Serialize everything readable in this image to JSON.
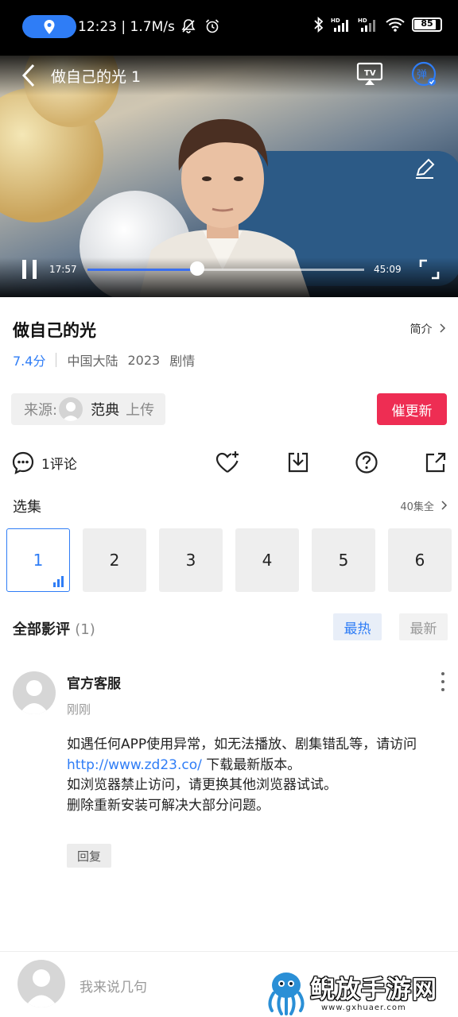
{
  "status": {
    "time": "12:23",
    "speed": "1.7M/s",
    "battery": "85"
  },
  "player": {
    "title": "做自己的光 1",
    "current_time": "17:57",
    "total_time": "45:09",
    "progress": 0.397,
    "danmaku_label": "弹",
    "tv_label": "TV"
  },
  "info": {
    "title": "做自己的光",
    "intro_label": "简介",
    "rating": "7.4分",
    "region": "中国大陆",
    "year": "2023",
    "genre": "剧情",
    "source_label": "来源:",
    "uploader": "范典",
    "upload_label": "上传",
    "urge_button": "催更新"
  },
  "actions": {
    "comment_count": "1评论"
  },
  "episodes": {
    "label": "选集",
    "total": "40集全",
    "items": [
      "1",
      "2",
      "3",
      "4",
      "5",
      "6"
    ],
    "active_index": 0
  },
  "reviews": {
    "label": "全部影评",
    "count": "(1)",
    "sort_hot": "最热",
    "sort_new": "最新",
    "comment": {
      "author": "官方客服",
      "time": "刚刚",
      "line1": "如遇任何APP使用异常，如无法播放、剧集错乱等，请访问",
      "link": "http://www.zd23.co/",
      "line2": "下载最新版本。",
      "line3": "如浏览器禁止访问，请更换其他浏览器试试。",
      "line4": "删除重新安装可解决大部分问题。",
      "reply_label": "回复"
    }
  },
  "bottom": {
    "input_placeholder": "我来说几句"
  },
  "watermark": {
    "text": "鲵放手游网",
    "url": "www.gxhuaer.com"
  },
  "colors": {
    "accent": "#2f7df6",
    "urge": "#ee2d53"
  }
}
